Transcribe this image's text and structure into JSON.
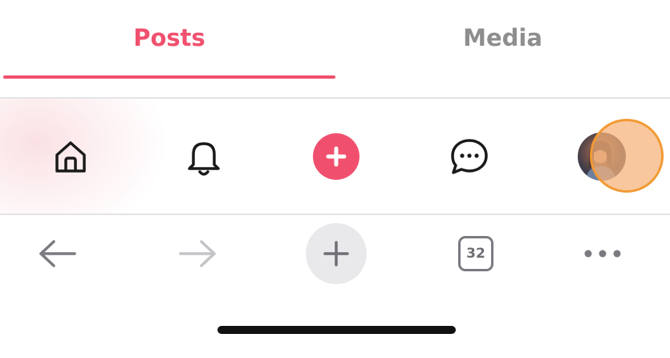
{
  "tabs": {
    "posts_label": "Posts",
    "media_label": "Media",
    "active": "posts"
  },
  "app_nav": {
    "items": [
      {
        "id": "home",
        "icon": "home-icon"
      },
      {
        "id": "notifications",
        "icon": "bell-icon"
      },
      {
        "id": "compose",
        "icon": "plus-icon"
      },
      {
        "id": "messages",
        "icon": "chat-bubble-icon"
      },
      {
        "id": "profile",
        "icon": "avatar"
      }
    ]
  },
  "browser_toolbar": {
    "back_icon": "arrow-left-icon",
    "forward_icon": "arrow-right-icon",
    "new_tab_icon": "plus-icon",
    "tab_count": "32",
    "more_icon": "ellipsis-icon"
  },
  "colors": {
    "accent": "#f0506e",
    "inactive_tab_text": "#8e8e8e",
    "icon_dark": "#1a1a1a",
    "browser_icon": "#7a7a80",
    "browser_icon_disabled": "#c4c4c8",
    "touch_indicator": "#f29a35"
  }
}
